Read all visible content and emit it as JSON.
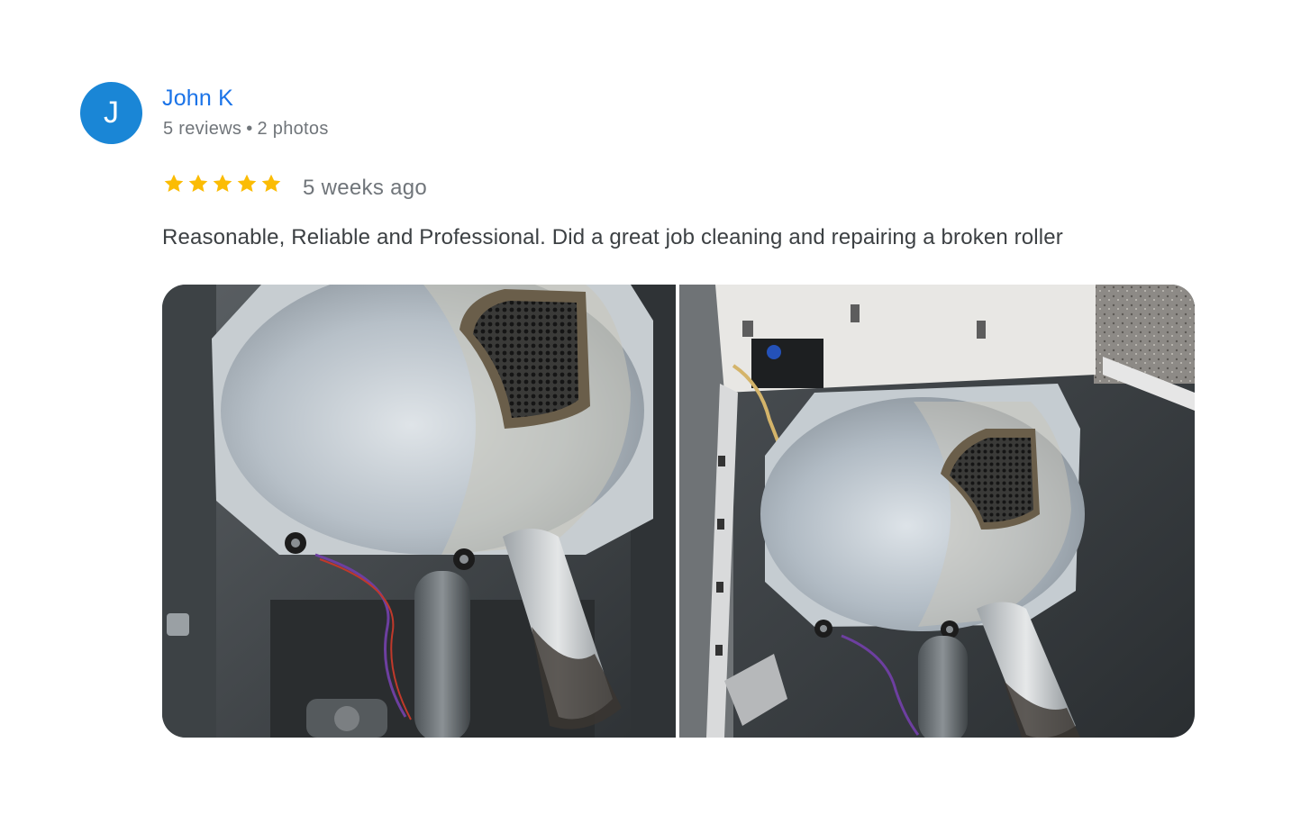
{
  "reviewer": {
    "initial": "J",
    "name": "John K",
    "review_count": "5 reviews",
    "photo_count": "2 photos",
    "separator": "•",
    "avatar_color": "#1a86d6",
    "name_color": "#1a73e8"
  },
  "review": {
    "rating": 5,
    "rating_max": 5,
    "star_icon": "star-icon",
    "star_color": "#fbbc04",
    "time_ago": "5 weeks ago",
    "text": "Reasonable, Reliable and Professional. Did a great job cleaning and repairing a broken roller"
  },
  "photos": [
    {
      "name": "review-photo-1",
      "subject": "dryer drum rear panel with rollers, before"
    },
    {
      "name": "review-photo-2",
      "subject": "dryer cabinet with drum installed, after"
    }
  ]
}
